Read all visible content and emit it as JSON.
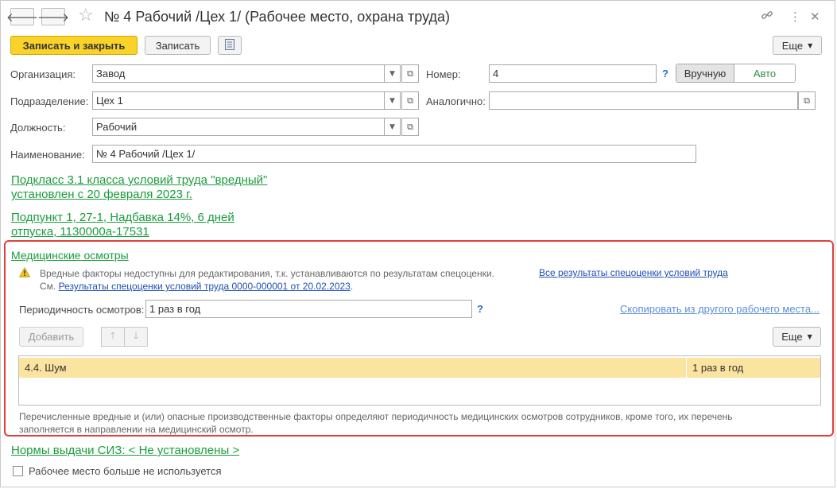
{
  "window": {
    "title": "№ 4 Рабочий /Цех 1/ (Рабочее место, охрана труда)",
    "nav_back_icon": "arrow-left-icon",
    "nav_forward_icon": "arrow-right-icon",
    "favorite_icon": "star-icon",
    "link_icon": "link-icon",
    "menu_icon": "more-vertical-icon",
    "close_icon": "close-icon"
  },
  "toolbar": {
    "save_close_label": "Записать и закрыть",
    "save_label": "Записать",
    "more_label": "Еще",
    "report_icon": "document-list-icon"
  },
  "form": {
    "organization_label": "Организация:",
    "organization_value": "Завод",
    "department_label": "Подразделение:",
    "department_value": "Цех 1",
    "position_label": "Должность:",
    "position_value": "Рабочий",
    "name_label": "Наименование:",
    "name_value": "№ 4 Рабочий /Цех 1/",
    "number_label": "Номер:",
    "number_value": "4",
    "number_help": "?",
    "mode_manual_label": "Вручную",
    "mode_auto_label": "Авто",
    "similar_label": "Аналогично:",
    "similar_value": ""
  },
  "links": {
    "subclass_line1": "Подкласс 3.1 класса условий труда \"вредный\"",
    "subclass_line2": "установлен с 20 февраля 2023 г.",
    "allowance_line1": "Подпункт 1, 27-1, Надбавка 14%, 6 дней",
    "allowance_line2": "отпуска, 1130000а-17531"
  },
  "medical": {
    "section_title": "Медицинские осмотры",
    "warning_text": "Вредные факторы недоступны для редактирования, т.к. устанавливаются по результатам спецоценки.",
    "all_results_link": "Все результаты спецоценки условий труда",
    "see_prefix": "См.",
    "results_link": "Результаты спецоценки условий труда 0000-000001 от 20.02.2023",
    "results_suffix": ".",
    "periodicity_label": "Периодичность осмотров:",
    "periodicity_value": "1 раз в год",
    "periodicity_help": "?",
    "copy_link": "Скопировать из другого рабочего места...",
    "add_label": "Добавить",
    "more_label": "Еще",
    "up_icon": "arrow-up-icon",
    "down_icon": "arrow-down-icon",
    "rows": [
      {
        "factor": "4.4. Шум",
        "period": "1 раз в год"
      }
    ],
    "footer_line1": "Перечисленные вредные и (или) опасные производственные факторы определяют периодичность медицинских осмотров сотрудников, кроме того, их перечень",
    "footer_line2": "заполняется в направлении на медицинский осмотр."
  },
  "ppe": {
    "link": "Нормы выдачи СИЗ: < Не установлены >"
  },
  "unused": {
    "checkbox_label": "Рабочее место больше не используется",
    "checked": false
  },
  "colors": {
    "accent_yellow": "#fad32a",
    "link_green": "#1a9d3c",
    "highlight_red": "#e0413c",
    "row_selected": "#fbe3a0"
  }
}
